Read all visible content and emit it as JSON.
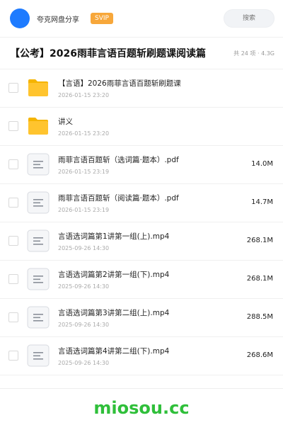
{
  "header": {
    "username": "夸克网盘分享",
    "badge": "SVIP",
    "search_placeholder": "搜索"
  },
  "folder": {
    "title": "【公考】2026雨菲言语百题斩刷题课阅读篇",
    "meta": "共 24 项 · 4.3G"
  },
  "items": [
    {
      "type": "folder",
      "icon": "folder-icon",
      "name": "【言语】2026雨菲言语百题斩刷题课",
      "date": "2026-01-15 23:20",
      "size": ""
    },
    {
      "type": "folder",
      "icon": "folder-icon",
      "name": "讲义",
      "date": "2026-01-15 23:20",
      "size": ""
    },
    {
      "type": "file",
      "icon": "document-icon",
      "name": "雨菲言语百题斩（选词篇·题本）.pdf",
      "date": "2026-01-15 23:19",
      "size": "14.0M"
    },
    {
      "type": "file",
      "icon": "document-icon",
      "name": "雨菲言语百题斩（阅读篇·题本）.pdf",
      "date": "2026-01-15 23:19",
      "size": "14.7M"
    },
    {
      "type": "file",
      "icon": "document-icon",
      "name": "言语选词篇第1讲第一组(上).mp4",
      "date": "2025-09-26 14:30",
      "size": "268.1M"
    },
    {
      "type": "file",
      "icon": "document-icon",
      "name": "言语选词篇第2讲第一组(下).mp4",
      "date": "2025-09-26 14:30",
      "size": "268.1M"
    },
    {
      "type": "file",
      "icon": "document-icon",
      "name": "言语选词篇第3讲第二组(上).mp4",
      "date": "2025-09-26 14:30",
      "size": "288.5M"
    },
    {
      "type": "file",
      "icon": "document-icon",
      "name": "言语选词篇第4讲第二组(下).mp4",
      "date": "2025-09-26 14:30",
      "size": "268.6M"
    }
  ],
  "watermark": "miosou.cc",
  "colors": {
    "avatar": "#1e7bff",
    "badge": "#f7a73a",
    "folder": "#ffc42e",
    "watermark": "#2fbf3a"
  }
}
